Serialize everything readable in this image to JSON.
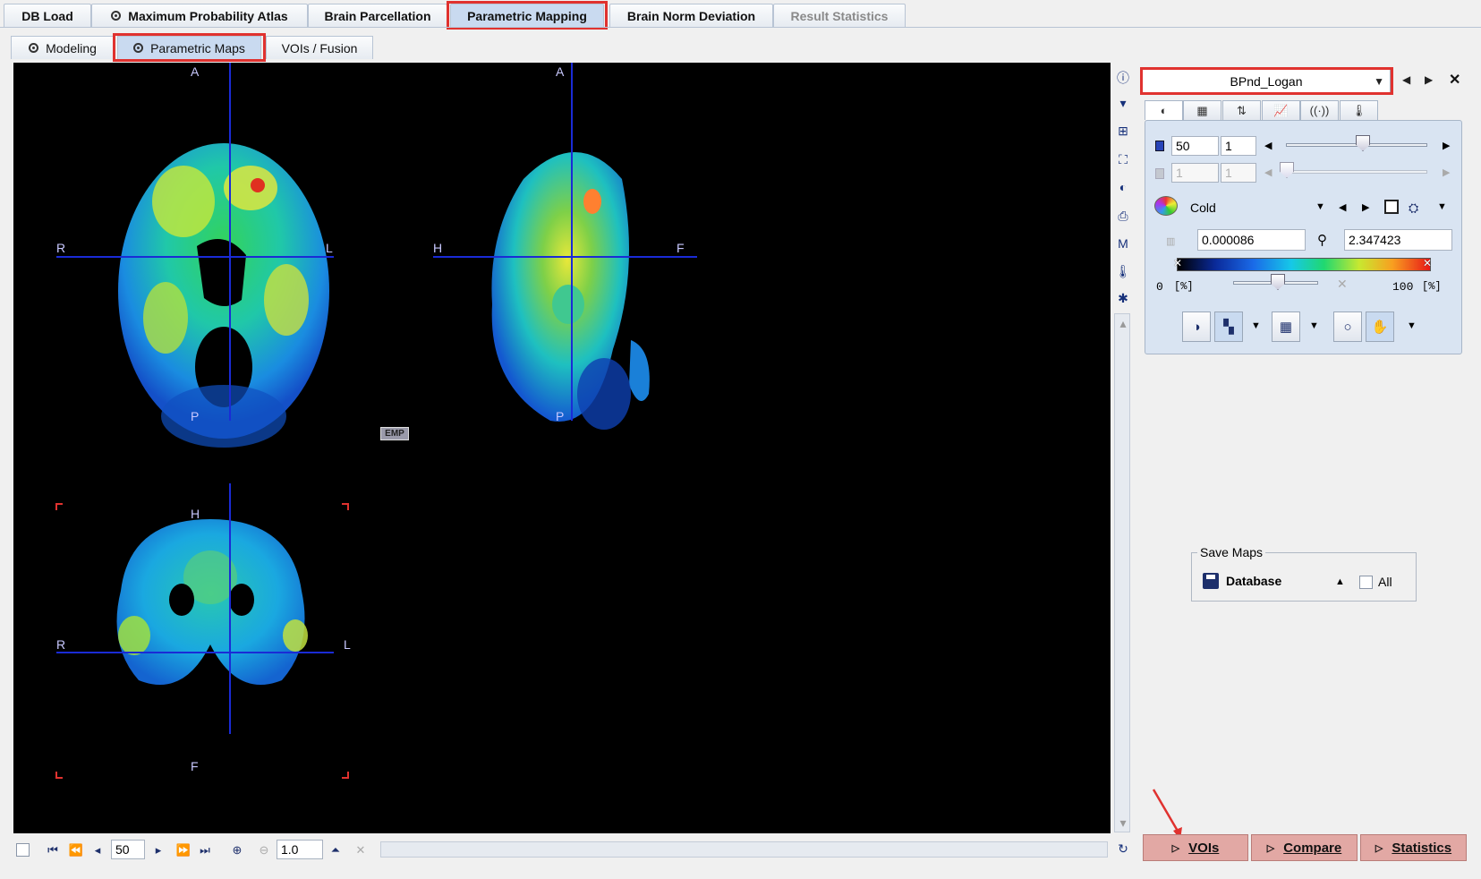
{
  "top_tabs": [
    {
      "label": "DB Load"
    },
    {
      "label": "Maximum Probability Atlas"
    },
    {
      "label": "Brain Parcellation"
    },
    {
      "label": "Parametric Mapping"
    },
    {
      "label": "Brain Norm Deviation"
    },
    {
      "label": "Result Statistics"
    }
  ],
  "sub_tabs": [
    {
      "label": "Modeling"
    },
    {
      "label": "Parametric Maps"
    },
    {
      "label": "VOIs / Fusion"
    }
  ],
  "viewer": {
    "axial": {
      "top": "A",
      "bottom": "P",
      "left": "R",
      "right": "L"
    },
    "sagittal": {
      "top": "A",
      "bottom": "P",
      "left": "H",
      "right": "F"
    },
    "coronal": {
      "top": "H",
      "bottom": "F",
      "left": "R",
      "right": "L"
    },
    "emp_badge": "EMP"
  },
  "bottom_toolbar": {
    "slice_value": "50",
    "zoom_value": "1.0"
  },
  "right_panel": {
    "map_selector": "BPnd_Logan",
    "frame": {
      "value1": "50",
      "value2": "1",
      "disabled1": "1",
      "disabled2": "1"
    },
    "colormap": {
      "name": "Cold",
      "min": "0.000086",
      "max": "2.347423",
      "pct_min": "0",
      "pct_unit_min": "[%]",
      "pct_max": "100",
      "pct_unit_max": "[%]"
    },
    "save_maps": {
      "title": "Save Maps",
      "target": "Database",
      "all_label": "All"
    }
  },
  "action_buttons": {
    "vois": "VOIs",
    "compare": "Compare",
    "statistics": "Statistics"
  },
  "colors": {
    "highlight": "#e0322f",
    "crosshair": "#1a2bd6",
    "action_button": "#e2a8a4",
    "active_tab": "#c9daf0"
  }
}
